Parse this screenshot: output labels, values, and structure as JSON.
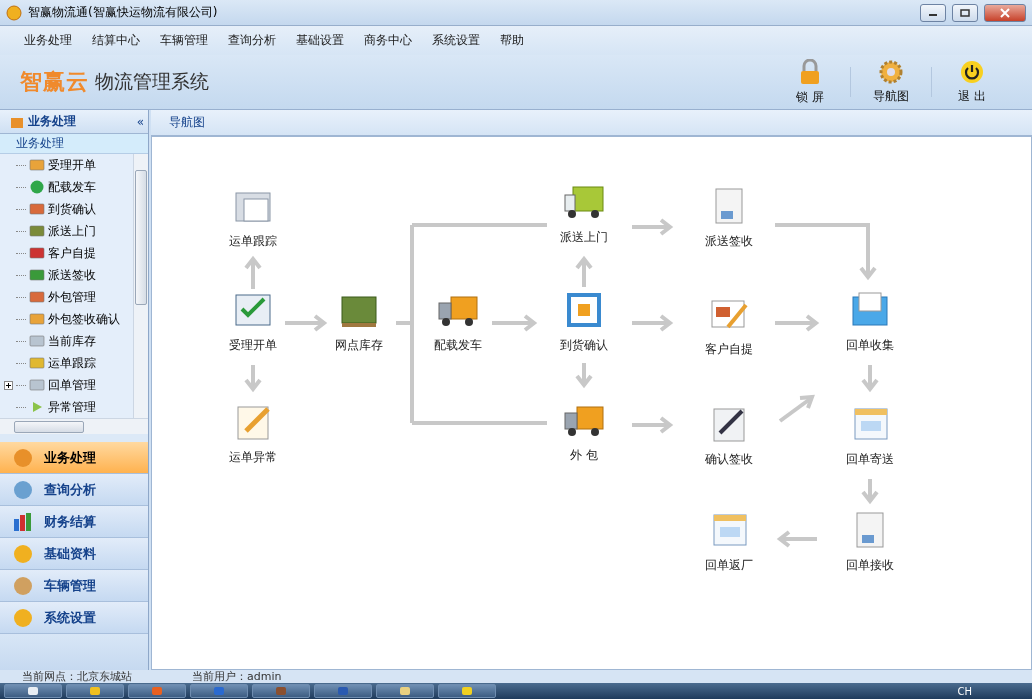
{
  "window": {
    "title": "智赢物流通(智赢快运物流有限公司)"
  },
  "menu": [
    "业务处理",
    "结算中心",
    "车辆管理",
    "查询分析",
    "基础设置",
    "商务中心",
    "系统设置",
    "帮助"
  ],
  "header": {
    "logo": "智赢云",
    "system_name": "物流管理系统",
    "tools": [
      "锁 屏",
      "导航图",
      "退 出"
    ]
  },
  "sidebar": {
    "title": "业务处理",
    "collapse": "«",
    "group": "业务处理",
    "tree": [
      {
        "label": "受理开单",
        "expandable": false
      },
      {
        "label": "配载发车",
        "expandable": false
      },
      {
        "label": "到货确认",
        "expandable": false
      },
      {
        "label": "派送上门",
        "expandable": false
      },
      {
        "label": "客户自提",
        "expandable": false
      },
      {
        "label": "派送签收",
        "expandable": false
      },
      {
        "label": "外包管理",
        "expandable": false
      },
      {
        "label": "外包签收确认",
        "expandable": false
      },
      {
        "label": "当前库存",
        "expandable": false
      },
      {
        "label": "运单跟踪",
        "expandable": false
      },
      {
        "label": "回单管理",
        "expandable": true
      },
      {
        "label": "异常管理",
        "expandable": false
      }
    ],
    "sections": [
      {
        "label": "业务处理",
        "selected": true
      },
      {
        "label": "查询分析",
        "selected": false
      },
      {
        "label": "财务结算",
        "selected": false
      },
      {
        "label": "基础资料",
        "selected": false
      },
      {
        "label": "车辆管理",
        "selected": false
      },
      {
        "label": "系统设置",
        "selected": false
      }
    ]
  },
  "content": {
    "tab": "导航图",
    "nodes": [
      "运单跟踪",
      "受理开单",
      "运单异常",
      "网点库存",
      "配载发车",
      "派送上门",
      "到货确认",
      "外 包",
      "派送签收",
      "客户自提",
      "确认签收",
      "回单收集",
      "回单寄送",
      "回单接收",
      "回单返厂"
    ]
  },
  "status_bar": [
    "当前网点：北京东城站",
    "当前用户：admin"
  ],
  "taskbar": {
    "language": "CH"
  }
}
